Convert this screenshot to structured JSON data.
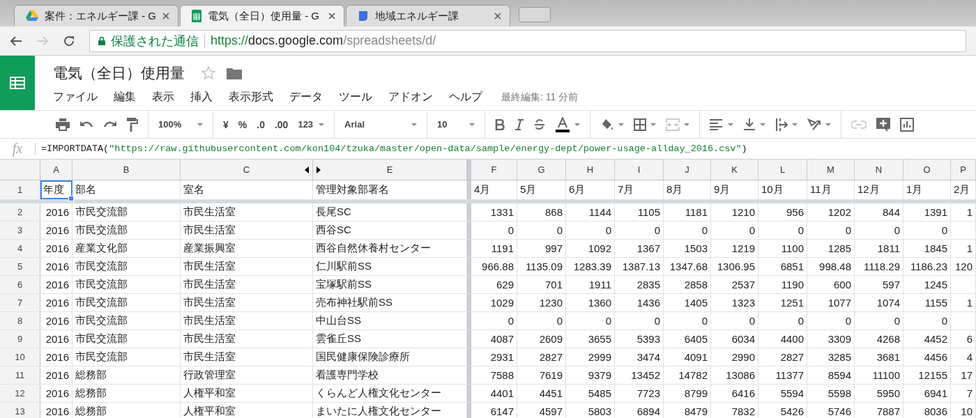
{
  "browser": {
    "tabs": [
      {
        "title": "案件：エネルギー課 - G",
        "selected": false,
        "kind": "drive"
      },
      {
        "title": "電気（全日）使用量 - G",
        "selected": true,
        "kind": "sheets"
      },
      {
        "title": "地域エネルギー課",
        "selected": false,
        "kind": "sites"
      }
    ],
    "security_label": "保護された通信",
    "url_scheme": "https://",
    "url_host": "docs.google.com",
    "url_path": "/spreadsheets/d/"
  },
  "document": {
    "title": "電気（全日）使用量",
    "starred": false,
    "menu": [
      "ファイル",
      "編集",
      "表示",
      "挿入",
      "表示形式",
      "データ",
      "ツール",
      "アドオン",
      "ヘルプ"
    ],
    "last_edit": "最終編集: 11 分前"
  },
  "toolbar": {
    "zoom": "100%",
    "currency": "¥",
    "percent": "%",
    "decimal_decrease": ".0",
    "decimal_increase": ".00",
    "number_format": "123",
    "font": "Arial",
    "font_size": "10",
    "merge_disabled": true,
    "link_disabled": true
  },
  "formula": {
    "label": "fx",
    "prefix": "=IMPORTDATA(",
    "string": "\"https://raw.githubusercontent.com/kon104/tzuka/master/open-data/sample/energy-dept/power-usage-allday_2016.csv\"",
    "suffix": ")"
  },
  "sheet": {
    "columns": [
      "A",
      "B",
      "C",
      "E",
      "F",
      "G",
      "H",
      "I",
      "J",
      "K",
      "L",
      "M",
      "N",
      "O",
      "P"
    ],
    "header_row": {
      "number": "1",
      "cells": [
        {
          "text": "年度",
          "selected": true
        },
        {
          "text": "部名",
          "selected": false
        },
        {
          "text": "室名",
          "selected": false
        },
        {
          "text": "管理対象部署名",
          "selected": false
        },
        {
          "text": "4月",
          "selected": false
        },
        {
          "text": "5月",
          "selected": false
        },
        {
          "text": "6月",
          "selected": false
        },
        {
          "text": "7月",
          "selected": false
        },
        {
          "text": "8月",
          "selected": false
        },
        {
          "text": "9月",
          "selected": false
        },
        {
          "text": "10月",
          "selected": false
        },
        {
          "text": "11月",
          "selected": false
        },
        {
          "text": "12月",
          "selected": false
        },
        {
          "text": "1月",
          "selected": false
        },
        {
          "text": "2月",
          "selected": false
        }
      ]
    },
    "rows": [
      {
        "number": "2",
        "cells": [
          "2016",
          "市民交流部",
          "市民生活室",
          "長尾SC",
          "1331",
          "868",
          "1144",
          "1105",
          "1181",
          "1210",
          "956",
          "1202",
          "844",
          "1391",
          "1"
        ]
      },
      {
        "number": "3",
        "cells": [
          "2016",
          "市民交流部",
          "市民生活室",
          "西谷SC",
          "0",
          "0",
          "0",
          "0",
          "0",
          "0",
          "0",
          "0",
          "0",
          "0",
          null
        ]
      },
      {
        "number": "4",
        "cells": [
          "2016",
          "産業文化部",
          "産業振興室",
          "西谷自然休養村センター",
          "1191",
          "997",
          "1092",
          "1367",
          "1503",
          "1219",
          "1100",
          "1285",
          "1811",
          "1845",
          "1"
        ]
      },
      {
        "number": "5",
        "cells": [
          "2016",
          "市民交流部",
          "市民生活室",
          "仁川駅前SS",
          "966.88",
          "1135.09",
          "1283.39",
          "1387.13",
          "1347.68",
          "1306.95",
          "6851",
          "998.48",
          "1118.29",
          "1186.23",
          "120"
        ]
      },
      {
        "number": "6",
        "cells": [
          "2016",
          "市民交流部",
          "市民生活室",
          "宝塚駅前SS",
          "629",
          "701",
          "1911",
          "2835",
          "2858",
          "2537",
          "1190",
          "600",
          "597",
          "1245",
          null
        ]
      },
      {
        "number": "7",
        "cells": [
          "2016",
          "市民交流部",
          "市民生活室",
          "売布神社駅前SS",
          "1029",
          "1230",
          "1360",
          "1436",
          "1405",
          "1323",
          "1251",
          "1077",
          "1074",
          "1155",
          "1"
        ]
      },
      {
        "number": "8",
        "cells": [
          "2016",
          "市民交流部",
          "市民生活室",
          "中山台SS",
          "0",
          "0",
          "0",
          "0",
          "0",
          "0",
          "0",
          "0",
          "0",
          "0",
          null
        ]
      },
      {
        "number": "9",
        "cells": [
          "2016",
          "市民交流部",
          "市民生活室",
          "雲雀丘SS",
          "4087",
          "2609",
          "3655",
          "5393",
          "6405",
          "6034",
          "4400",
          "3309",
          "4268",
          "4452",
          "6"
        ]
      },
      {
        "number": "10",
        "cells": [
          "2016",
          "市民交流部",
          "市民生活室",
          "国民健康保険診療所",
          "2931",
          "2827",
          "2999",
          "3474",
          "4091",
          "2990",
          "2827",
          "3285",
          "3681",
          "4456",
          "4"
        ]
      },
      {
        "number": "11",
        "cells": [
          "2016",
          "総務部",
          "行政管理室",
          "看護専門学校",
          "7588",
          "7619",
          "9379",
          "13452",
          "14782",
          "13086",
          "11377",
          "8594",
          "11100",
          "12155",
          "17"
        ]
      },
      {
        "number": "12",
        "cells": [
          "2016",
          "総務部",
          "人権平和室",
          "くらんど人権文化センター",
          "4401",
          "4451",
          "5485",
          "7723",
          "8799",
          "6416",
          "5594",
          "5598",
          "5950",
          "6941",
          "7"
        ]
      },
      {
        "number": "13",
        "cells": [
          "2016",
          "総務部",
          "人権平和室",
          "まいたに人権文化センター",
          "6147",
          "4597",
          "5803",
          "6894",
          "8479",
          "7832",
          "5426",
          "5746",
          "7887",
          "8036",
          "10"
        ]
      }
    ]
  }
}
